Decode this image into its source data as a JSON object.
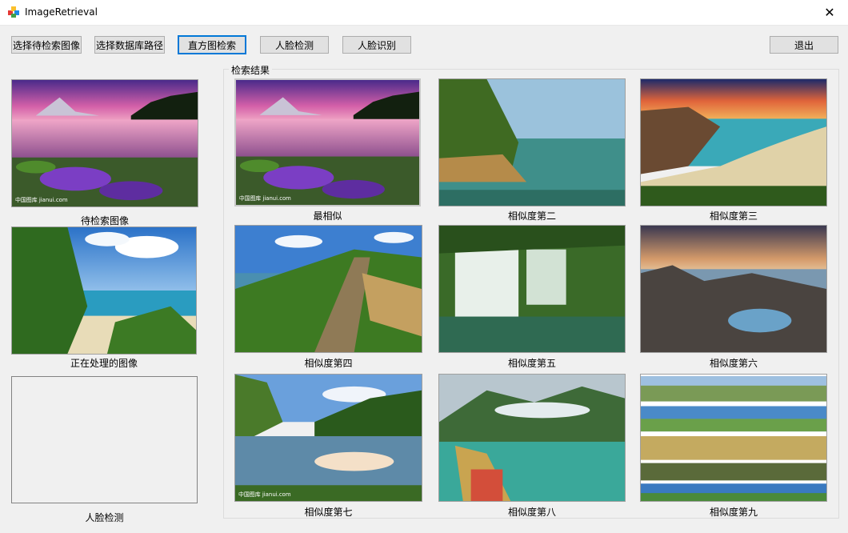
{
  "window": {
    "title": "ImageRetrieval",
    "close_glyph": "✕"
  },
  "toolbar": {
    "select_query": "选择待检索图像",
    "select_db": "选择数据库路径",
    "histogram_search": "直方图检索",
    "face_detect": "人脸检测",
    "face_recognize": "人脸识别",
    "exit": "退出"
  },
  "left_panel": {
    "query_caption": "待检索图像",
    "processing_caption": "正在处理的图像",
    "face_caption": "人脸检测"
  },
  "results": {
    "group_title": "检索结果",
    "captions": [
      "最相似",
      "相似度第二",
      "相似度第三",
      "相似度第四",
      "相似度第五",
      "相似度第六",
      "相似度第七",
      "相似度第八",
      "相似度第九"
    ]
  },
  "watermark": "中国图库 jianui.com",
  "icons": {
    "app": "app-icon",
    "close": "close-icon"
  }
}
